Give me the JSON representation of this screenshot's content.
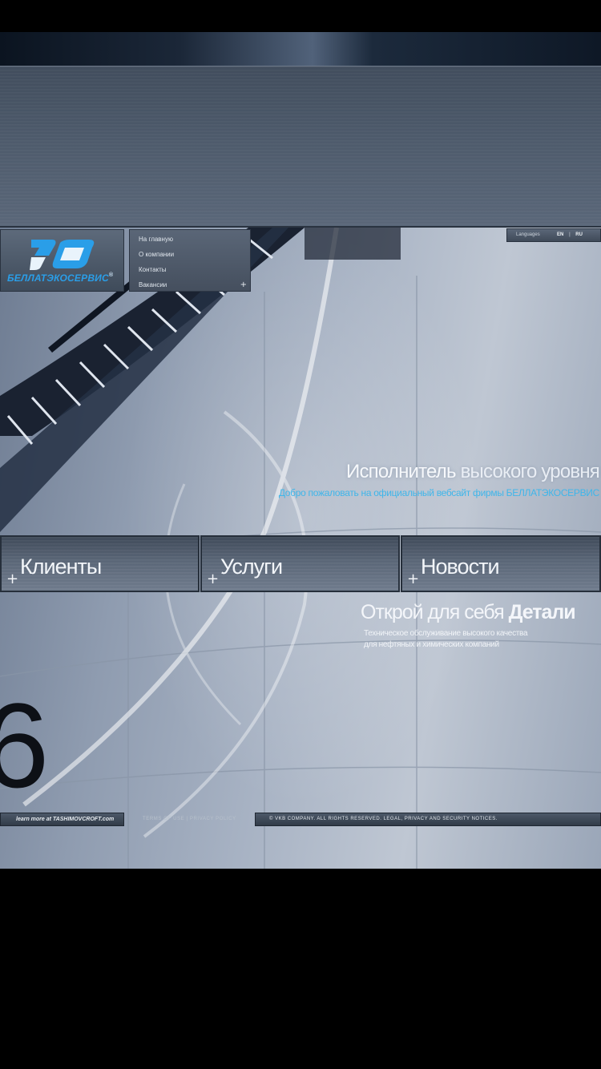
{
  "brand": {
    "name": "БЕЛЛАТЭКОСЕРВИС",
    "registered_mark": "®",
    "logo_color": "#2a9ee8"
  },
  "nav": {
    "items": [
      "На главную",
      "О компании",
      "Контакты",
      "Вакансии"
    ],
    "expand_symbol": "+"
  },
  "languages": {
    "label": "Languages",
    "options": [
      "EN",
      "RU"
    ],
    "separator": "|"
  },
  "hero": {
    "slogan_bold": "Исполнитель",
    "slogan_light": " высокого уровня",
    "welcome": "Добро пожаловать на официальный вебсайт фирмы БЕЛЛАТЭКОСЕРВИС",
    "welcome_color": "#3fb6ea",
    "decor_digit": "6"
  },
  "tiles": [
    {
      "label": "Клиенты",
      "plus": "+"
    },
    {
      "label": "Услуги",
      "plus": "+"
    },
    {
      "label": "Новости",
      "plus": "+"
    }
  ],
  "details": {
    "title_light": "Открой для себя ",
    "title_bold": "Детали",
    "line1": "Техническое обслуживание высокого качества",
    "line2": "для нефтяных и химических компаний"
  },
  "footer": {
    "learn_more": "learn more at TASHIMOVCROFT.com",
    "terms": "TERMS OF USE | PRIVACY POLICY",
    "copyright": "© VKB COMPANY. ALL RIGHTS RESERVED. LEGAL, PRIVACY AND SECURITY NOTICES."
  }
}
